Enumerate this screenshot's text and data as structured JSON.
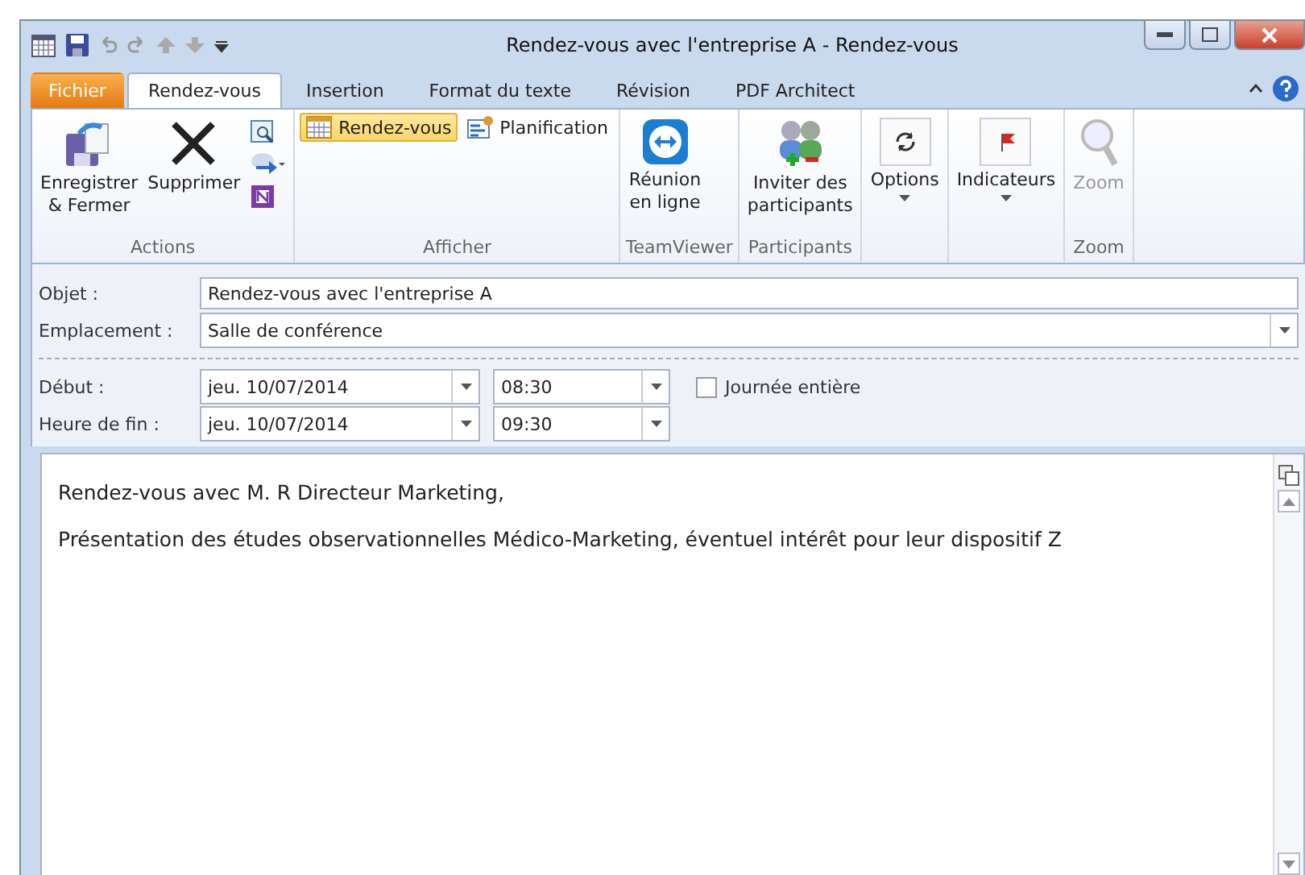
{
  "window": {
    "title": "Rendez-vous avec l'entreprise A  -  Rendez-vous"
  },
  "tabs": [
    {
      "label": "Fichier",
      "kind": "file",
      "selected": false
    },
    {
      "label": "Rendez-vous",
      "kind": "tab",
      "selected": true
    },
    {
      "label": "Insertion",
      "kind": "tab",
      "selected": false
    },
    {
      "label": "Format du texte",
      "kind": "tab",
      "selected": false
    },
    {
      "label": "Révision",
      "kind": "tab",
      "selected": false
    },
    {
      "label": "PDF Architect",
      "kind": "tab",
      "selected": false
    }
  ],
  "ribbon": [
    {
      "label": "Actions",
      "buttons": [
        {
          "kind": "large",
          "label": "Enregistrer\n& Fermer",
          "disabled": false,
          "dropdown": false
        },
        {
          "kind": "large",
          "label": "Supprimer",
          "disabled": false,
          "dropdown": false
        },
        {
          "kind": "iconstack"
        }
      ]
    },
    {
      "label": "Afficher",
      "buttons": [
        {
          "kind": "small",
          "label": "Rendez-vous",
          "selected": true
        },
        {
          "kind": "small",
          "label": "Planification",
          "selected": false
        }
      ]
    },
    {
      "label": "TeamViewer",
      "buttons": [
        {
          "kind": "large",
          "label": "Réunion\nen ligne",
          "disabled": false,
          "dropdown": false
        }
      ]
    },
    {
      "label": "Participants",
      "buttons": [
        {
          "kind": "large",
          "label": "Inviter des\nparticipants",
          "disabled": false,
          "dropdown": false
        }
      ]
    },
    {
      "buttons": [
        {
          "kind": "large",
          "label": "Options",
          "disabled": false,
          "dropdown": true
        }
      ]
    },
    {
      "buttons": [
        {
          "kind": "large",
          "label": "Indicateurs",
          "disabled": false,
          "dropdown": true
        }
      ]
    },
    {
      "label": "Zoom",
      "buttons": [
        {
          "kind": "large",
          "label": "Zoom",
          "disabled": true,
          "dropdown": false
        }
      ]
    }
  ],
  "form": {
    "subject": {
      "label": "Objet :",
      "value": "Rendez-vous avec l'entreprise A"
    },
    "location": {
      "label": "Emplacement :",
      "value": "Salle de conférence"
    },
    "start": {
      "label": "Début :",
      "date": "jeu. 10/07/2014",
      "time": "08:30"
    },
    "all_day": {
      "label": "Journée entière",
      "checked": false
    },
    "end": {
      "label": "Heure de fin :",
      "date": "jeu. 10/07/2014",
      "time": "09:30"
    }
  },
  "body": [
    "Rendez-vous avec M. R Directeur Marketing,",
    "Présentation des études observationnelles Médico-Marketing, éventuel intérêt pour leur dispositif Z"
  ]
}
